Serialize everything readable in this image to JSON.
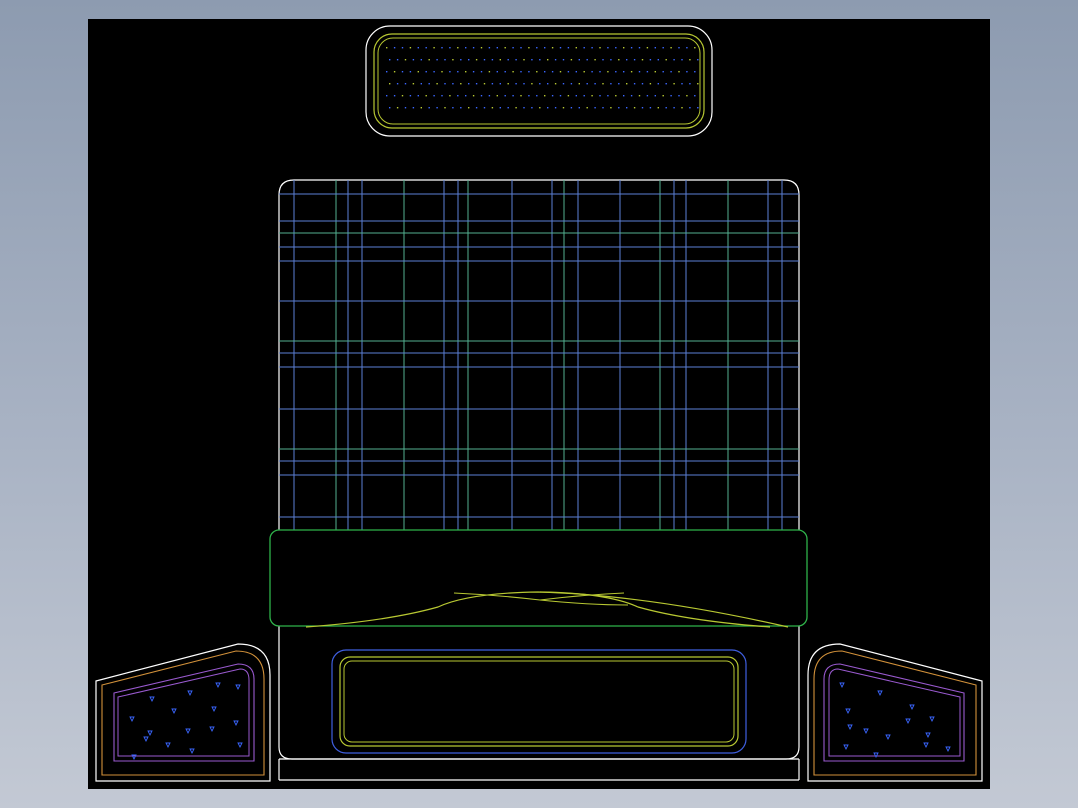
{
  "viewport": {
    "background": "#000000"
  },
  "palette": {
    "outline": "#ffffff",
    "grid_blue": "#5b7fd6",
    "grid_green": "#53b090",
    "yellow_green": "#b8c832",
    "green": "#2fb24a",
    "purple": "#9a5ad0",
    "orange": "#d2913a",
    "blue": "#3f5fe0",
    "speckle": "#3a66ff"
  },
  "drawing": {
    "subject": "bed plan view",
    "components": [
      "headboard-grille",
      "mattress-grid",
      "pillow-roll",
      "footboard-panel",
      "nightstand-left",
      "nightstand-right"
    ]
  }
}
